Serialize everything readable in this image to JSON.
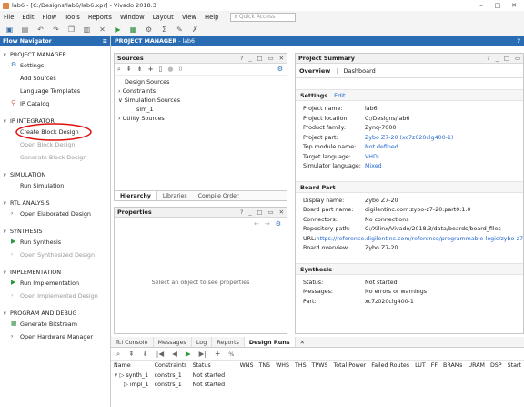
{
  "window": {
    "title": "lab6 - [C:/Designs/lab6/lab6.xpr] - Vivado 2018.3"
  },
  "menu": [
    "File",
    "Edit",
    "Flow",
    "Tools",
    "Reports",
    "Window",
    "Layout",
    "View",
    "Help"
  ],
  "quick_access": {
    "placeholder": "Quick Access"
  },
  "flow_navigator": {
    "title": "Flow Navigator",
    "sections": {
      "project_manager": {
        "label": "PROJECT MANAGER",
        "items": [
          "Settings",
          "Add Sources",
          "Language Templates",
          "IP Catalog"
        ]
      },
      "ip_integrator": {
        "label": "IP INTEGRATOR",
        "items": [
          "Create Block Design",
          "Open Block Design",
          "Generate Block Design"
        ]
      },
      "simulation": {
        "label": "SIMULATION",
        "items": [
          "Run Simulation"
        ]
      },
      "rtl_analysis": {
        "label": "RTL ANALYSIS",
        "items": [
          "Open Elaborated Design"
        ]
      },
      "synthesis": {
        "label": "SYNTHESIS",
        "items": [
          "Run Synthesis",
          "Open Synthesized Design"
        ]
      },
      "implementation": {
        "label": "IMPLEMENTATION",
        "items": [
          "Run Implementation",
          "Open Implemented Design"
        ]
      },
      "program_debug": {
        "label": "PROGRAM AND DEBUG",
        "items": [
          "Generate Bitstream",
          "Open Hardware Manager"
        ]
      }
    }
  },
  "main_header": {
    "title": "PROJECT MANAGER",
    "sub": " - lab6",
    "help": "?"
  },
  "sources": {
    "title": "Sources",
    "badge": "0",
    "tree": [
      "Design Sources",
      "Constraints",
      "Simulation Sources",
      "sim_1",
      "Utility Sources"
    ],
    "tabs": [
      "Hierarchy",
      "Libraries",
      "Compile Order"
    ]
  },
  "properties": {
    "title": "Properties",
    "empty": "Select an object to see properties"
  },
  "summary": {
    "title": "Project Summary",
    "tabs": [
      "Overview",
      "Dashboard"
    ],
    "settings": {
      "label": "Settings",
      "edit": "Edit",
      "rows": [
        {
          "k": "Project name:",
          "v": "lab6"
        },
        {
          "k": "Project location:",
          "v": "C:/Designs/lab6"
        },
        {
          "k": "Product family:",
          "v": "Zynq-7000"
        },
        {
          "k": "Project part:",
          "v": "Zybo Z7-20 (xc7z020clg400-1)"
        },
        {
          "k": "Top module name:",
          "v": "Not defined"
        },
        {
          "k": "Target language:",
          "v": "VHDL"
        },
        {
          "k": "Simulator language:",
          "v": "Mixed"
        }
      ]
    },
    "board": {
      "label": "Board Part",
      "rows": [
        {
          "k": "Display name:",
          "v": "Zybo Z7-20"
        },
        {
          "k": "Board part name:",
          "v": "digilentinc.com:zybo-z7-20:part0:1.0"
        },
        {
          "k": "Connectors:",
          "v": "No connections"
        },
        {
          "k": "Repository path:",
          "v": "C:/Xilinx/Vivado/2018.3/data/boards/board_files"
        },
        {
          "k": "URL:",
          "v": "https://reference.digilentinc.com/reference/programmable-logic/zybo-z7"
        },
        {
          "k": "Board overview:",
          "v": "Zybo Z7-20"
        }
      ]
    },
    "synthesis": {
      "label": "Synthesis",
      "rows": [
        {
          "k": "Status:",
          "v": "Not started"
        },
        {
          "k": "Messages:",
          "v": "No errors or warnings"
        },
        {
          "k": "Part:",
          "v": "xc7z020clg400-1"
        }
      ]
    }
  },
  "bottom": {
    "tabs": [
      "Tcl Console",
      "Messages",
      "Log",
      "Reports",
      "Design Runs"
    ],
    "table": {
      "headers": [
        "Name",
        "Constraints",
        "Status",
        "WNS",
        "TNS",
        "WHS",
        "THS",
        "TPWS",
        "Total Power",
        "Failed Routes",
        "LUT",
        "FF",
        "BRAMs",
        "URAM",
        "DSP",
        "Start"
      ],
      "rows": [
        {
          "name": "synth_1",
          "constraints": "constrs_1",
          "status": "Not started"
        },
        {
          "name": "impl_1",
          "constraints": "constrs_1",
          "status": "Not started"
        }
      ]
    }
  }
}
